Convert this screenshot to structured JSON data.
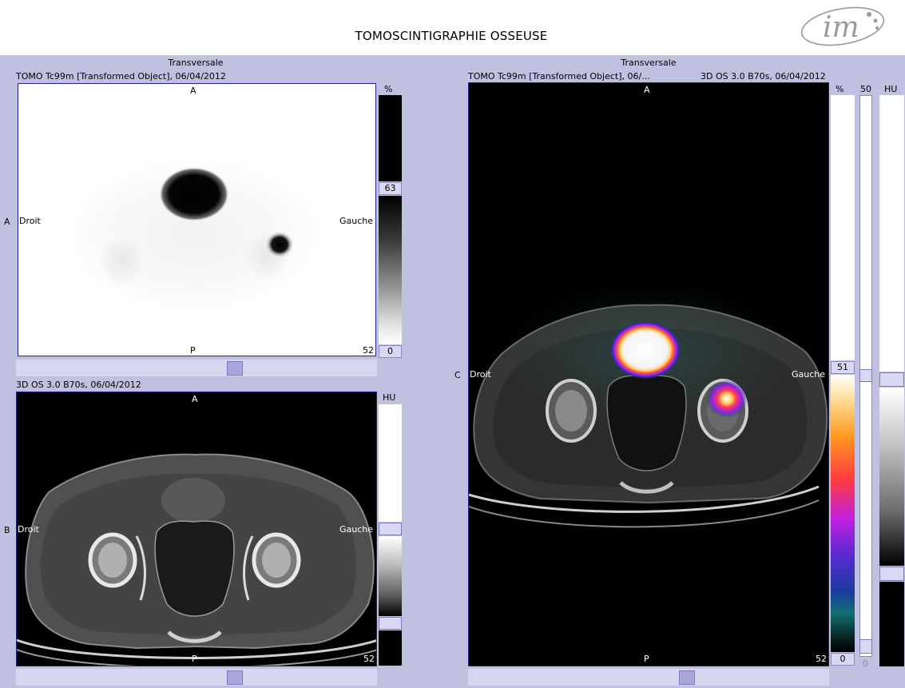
{
  "header": {
    "title": "TOMOSCINTIGRAPHIE OSSEUSE",
    "logo_text": "im"
  },
  "panel_a": {
    "orientation_title": "Transversale",
    "series_title": "TOMO Tc99m [Transformed Object], 06/04/2012",
    "side_letter": "A",
    "anterior": "A",
    "posterior": "P",
    "right_label": "Droit",
    "left_label": "Gauche",
    "slice_number": "52",
    "scale_unit": "%",
    "scale_max": "63",
    "scale_min": "0"
  },
  "panel_b": {
    "series_title": "3D OS  3.0  B70s, 06/04/2012",
    "side_letter": "B",
    "anterior": "A",
    "posterior": "P",
    "right_label": "Droit",
    "left_label": "Gauche",
    "slice_number": "52",
    "scale_unit": "HU"
  },
  "panel_c": {
    "orientation_title": "Transversale",
    "series_title_left": "TOMO Tc99m [Transformed Object], 06/...",
    "series_title_right": "3D OS  3.0  B70s, 06/04/2012",
    "side_letter": "C",
    "anterior": "A",
    "posterior": "P",
    "right_label": "Droit",
    "left_label": "Gauche",
    "slice_number": "52",
    "scale_unit": "%",
    "scale_max": "51",
    "scale_min": "0",
    "blend_value": "50",
    "blend_min": "0",
    "hu_unit": "HU"
  },
  "colors": {
    "background": "#c0c0e0",
    "border": "#22228a",
    "scroll": "#d6d6f0"
  }
}
